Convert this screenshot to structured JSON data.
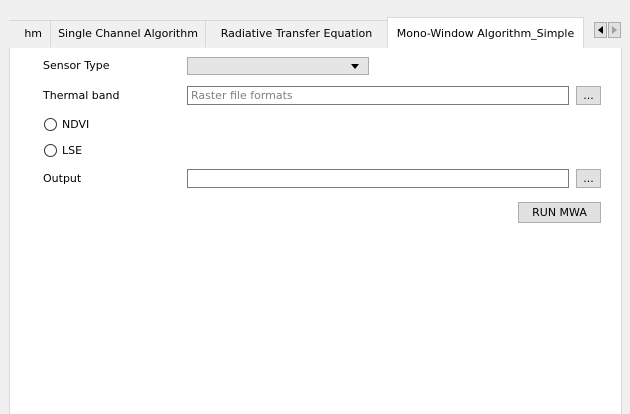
{
  "tabs": [
    {
      "label": "hm",
      "active": false
    },
    {
      "label": "Single Channel Algorithm",
      "active": false
    },
    {
      "label": "Radiative Transfer Equation",
      "active": false
    },
    {
      "label": "Mono-Window Algorithm_Simple",
      "active": true
    }
  ],
  "tab_scroll": {
    "left_icon": "triangle-left-icon",
    "right_icon": "triangle-right-icon"
  },
  "form": {
    "sensor_type": {
      "label": "Sensor Type",
      "value": "",
      "icon": "chevron-down-icon"
    },
    "thermal_band": {
      "label": "Thermal band",
      "value": "",
      "placeholder": "Raster file formats",
      "browse_label": "..."
    },
    "radios": [
      {
        "label": "NDVI",
        "checked": false
      },
      {
        "label": "LSE",
        "checked": false
      }
    ],
    "output": {
      "label": "Output",
      "value": "",
      "browse_label": "..."
    },
    "run_button_label": "RUN MWA"
  },
  "colors": {
    "window_bg": "#f0f0f0",
    "panel_bg": "#ffffff",
    "border": "#d9d9d9",
    "button_bg": "#e1e1e1",
    "combo_bg": "#e5e5e5"
  }
}
